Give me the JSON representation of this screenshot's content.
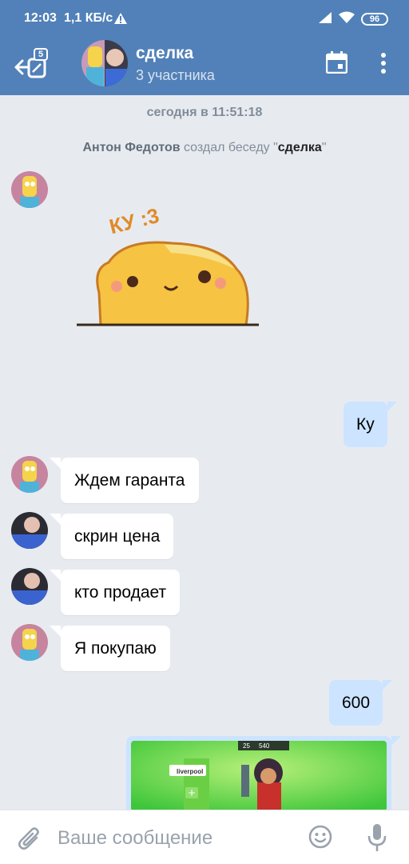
{
  "status_bar": {
    "time": "12:03",
    "speed": "1,1 КБ/с",
    "warning_icon": "warning-icon",
    "battery": "96"
  },
  "header": {
    "unread_count": "5",
    "title": "сделка",
    "subtitle": "3 участника",
    "accent_color": "#5181b8"
  },
  "conversation": {
    "date_separator": "сегодня в 11:51:18",
    "service_message": {
      "author": "Антон Федотов",
      "action": " создал беседу \"",
      "chat_name": "сделка",
      "tail": "\""
    },
    "messages": [
      {
        "direction": "in",
        "avatar": "simpson-avatar",
        "type": "sticker",
        "text": "КУ :3"
      },
      {
        "direction": "out",
        "type": "text",
        "text": "Ку"
      },
      {
        "direction": "in",
        "avatar": "simpson-avatar",
        "type": "text",
        "text": "Ждем гаранта"
      },
      {
        "direction": "in",
        "avatar": "girl-avatar",
        "type": "text",
        "text": "скрин цена"
      },
      {
        "direction": "in",
        "avatar": "girl-avatar",
        "type": "text",
        "text": "кто продает"
      },
      {
        "direction": "in",
        "avatar": "simpson-avatar",
        "type": "text",
        "text": "Я покупаю"
      },
      {
        "direction": "out",
        "type": "text",
        "text": "600"
      },
      {
        "direction": "out",
        "type": "image",
        "image_label": "liverpool",
        "stats": [
          "25",
          "540"
        ]
      }
    ]
  },
  "composer": {
    "placeholder": "Ваше сообщение"
  }
}
